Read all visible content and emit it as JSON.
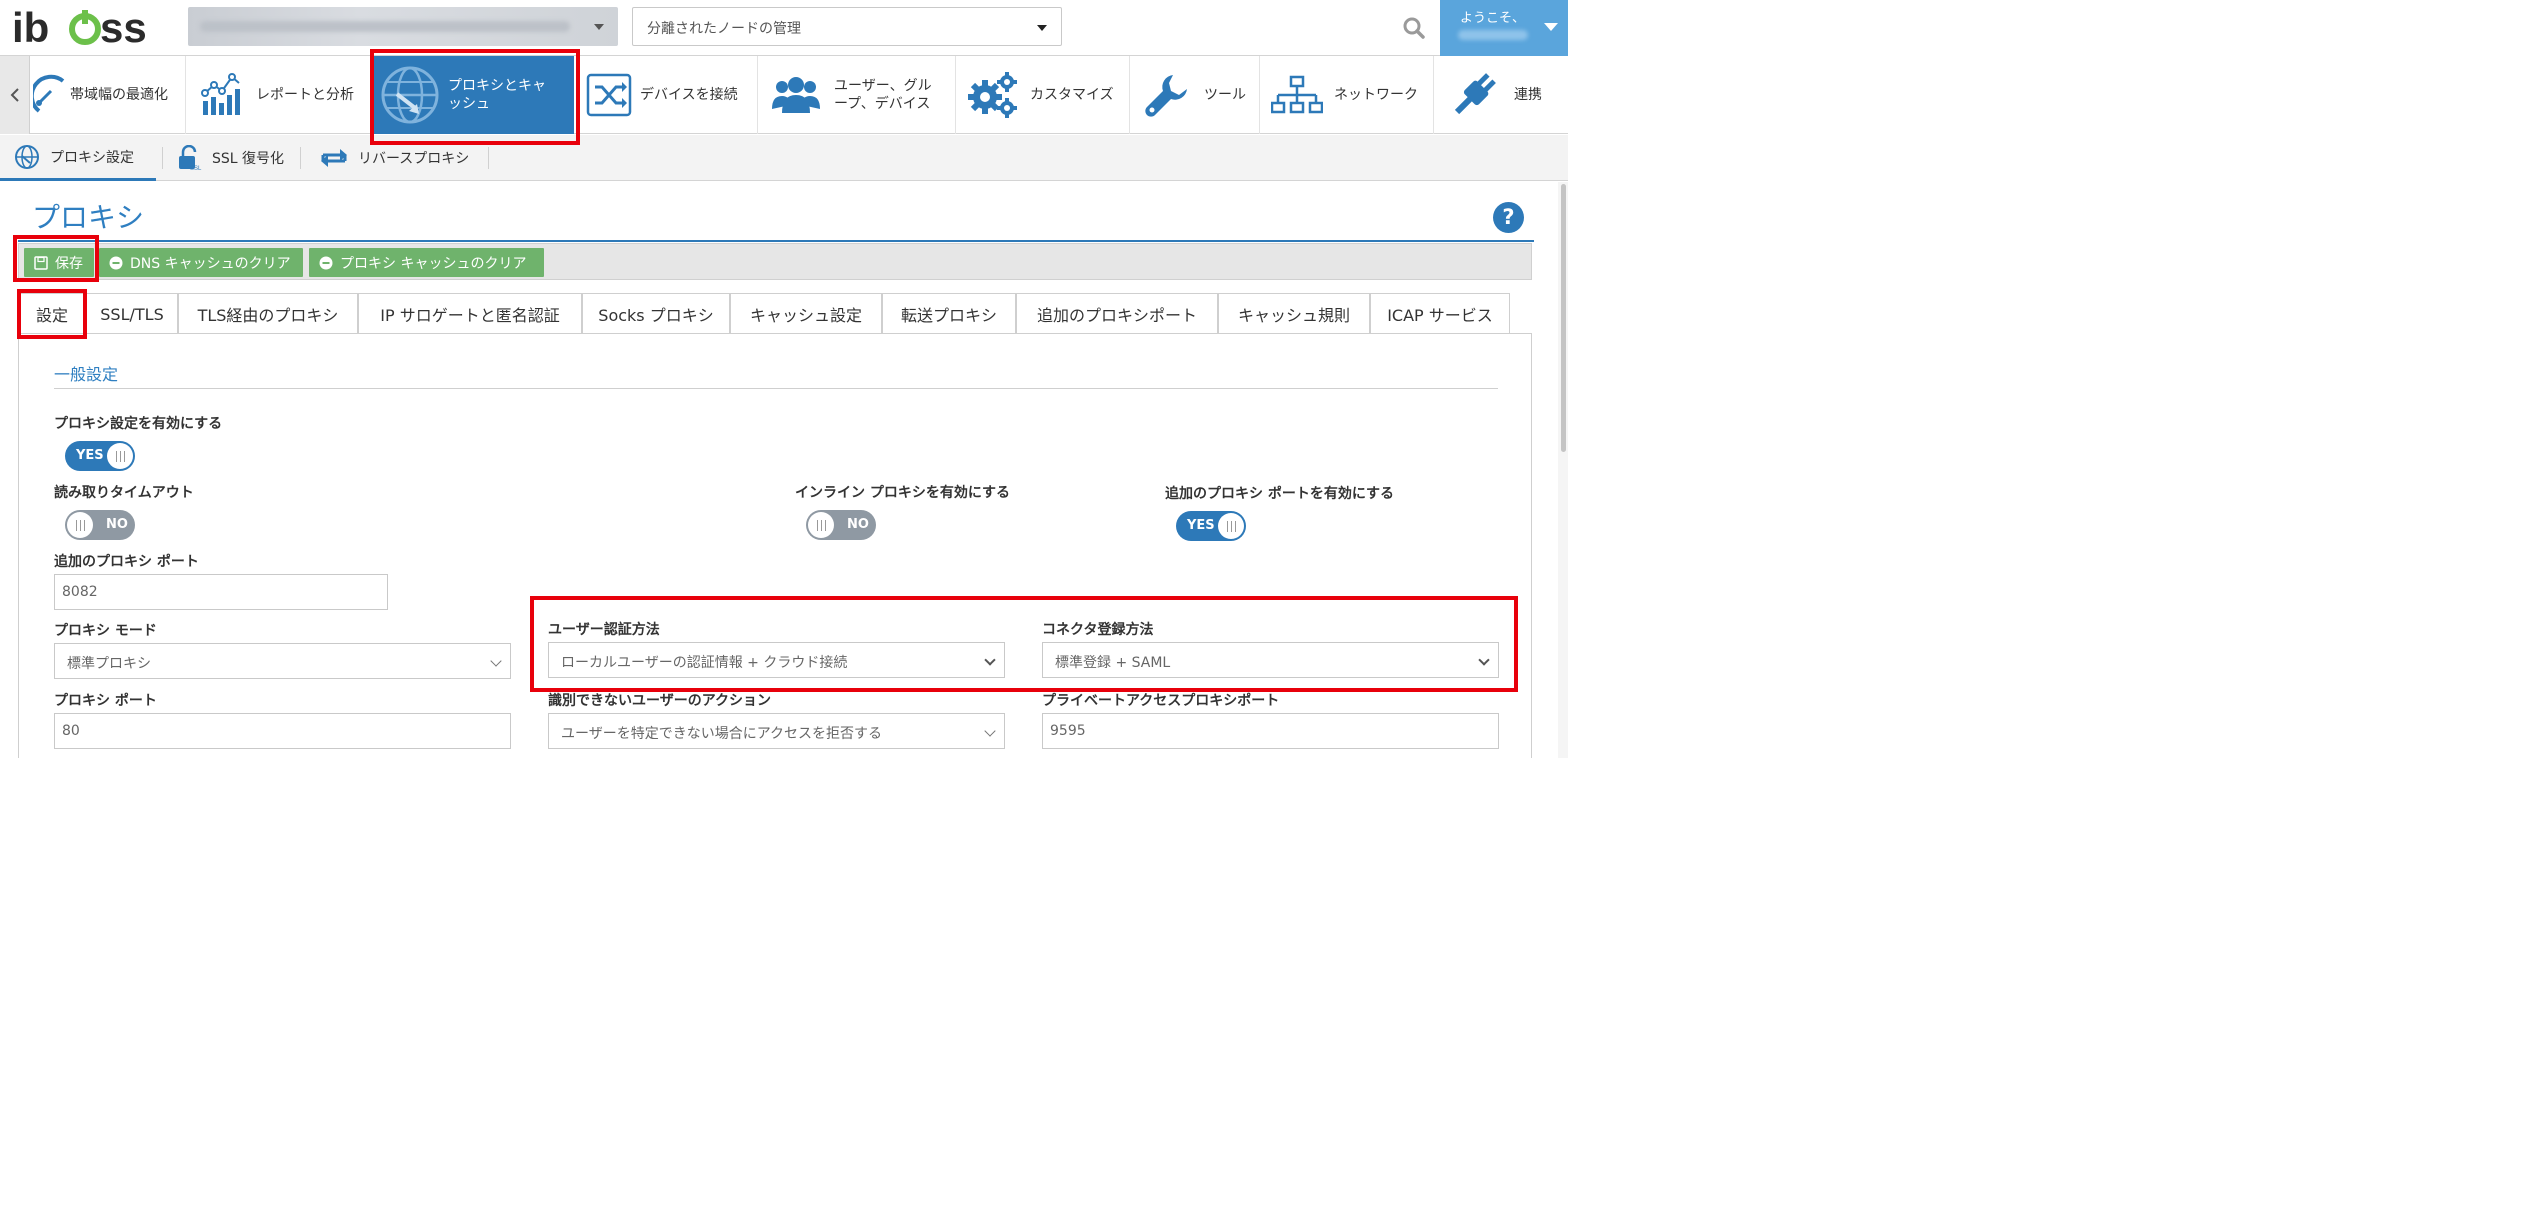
{
  "header": {
    "logo_text": "iboss",
    "node_select_value": "分離されたノードの管理",
    "welcome_label": "ようこそ、"
  },
  "modules": [
    {
      "label": "帯域幅の最適化",
      "icon": "speedometer-icon"
    },
    {
      "label": "レポートと分析",
      "icon": "analytics-chart-icon"
    },
    {
      "label": "プロキシとキャッシュ",
      "icon": "globe-proxy-icon",
      "active": true
    },
    {
      "label": "デバイスを接続",
      "icon": "shuffle-icon"
    },
    {
      "label": "ユーザー、グループ、デバイス",
      "icon": "users-icon"
    },
    {
      "label": "カスタマイズ",
      "icon": "gears-icon"
    },
    {
      "label": "ツール",
      "icon": "wrench-icon"
    },
    {
      "label": "ネットワーク",
      "icon": "network-tree-icon"
    },
    {
      "label": "連携",
      "icon": "plug-icon"
    }
  ],
  "module_labels": {
    "bandwidth": "帯域幅の最適化",
    "reports": "レポートと分析",
    "proxy_line1": "プロキシとキャ",
    "proxy_line2": "ッシュ",
    "connect": "デバイスを接続",
    "users_line1": "ユーザー、グル",
    "users_line2": "ープ、デバイス",
    "customize": "カスタマイズ",
    "tools": "ツール",
    "network": "ネットワーク",
    "integrations": "連携"
  },
  "subnav": {
    "proxy_settings": "プロキシ設定",
    "ssl_decrypt": "SSL 復号化",
    "reverse_proxy": "リバースプロキシ"
  },
  "page": {
    "title": "プロキシ",
    "help": "?"
  },
  "actions": {
    "save": "保存",
    "clear_dns": "DNS キャッシュのクリア",
    "clear_proxy": "プロキシ キャッシュのクリア"
  },
  "tabs": [
    "設定",
    "SSL/TLS",
    "TLS経由のプロキシ",
    "IP サロゲートと匿名認証",
    "Socks プロキシ",
    "キャッシュ設定",
    "転送プロキシ",
    "追加のプロキシポート",
    "キャッシュ規則",
    "ICAP サービス"
  ],
  "form": {
    "section_title": "一般設定",
    "enable_proxy_label": "プロキシ設定を有効にする",
    "enable_proxy_value": "YES",
    "read_timeout_label": "読み取りタイムアウト",
    "read_timeout_value": "NO",
    "inline_proxy_label": "インライン プロキシを有効にする",
    "inline_proxy_value": "NO",
    "additional_port_enable_label": "追加のプロキシ ポートを有効にする",
    "additional_port_enable_value": "YES",
    "additional_port_label": "追加のプロキシ ポート",
    "additional_port_value": "8082",
    "proxy_mode_label": "プロキシ モード",
    "proxy_mode_value": "標準プロキシ",
    "user_auth_label": "ユーザー認証方法",
    "user_auth_value": "ローカルユーザーの認証情報 + クラウド接続",
    "connector_reg_label": "コネクタ登録方法",
    "connector_reg_value": "標準登録 + SAML",
    "proxy_port_label": "プロキシ ポート",
    "proxy_port_value": "80",
    "unknown_user_label": "識別できないユーザーのアクション",
    "unknown_user_value": "ユーザーを特定できない場合にアクセスを拒否する",
    "private_port_label": "プライベートアクセスプロキシポート",
    "private_port_value": "9595"
  },
  "colors": {
    "primary": "#2d79b8",
    "action_green": "#6fb36c",
    "highlight_red": "#e8000b",
    "toggle_off": "#8f99a3"
  }
}
